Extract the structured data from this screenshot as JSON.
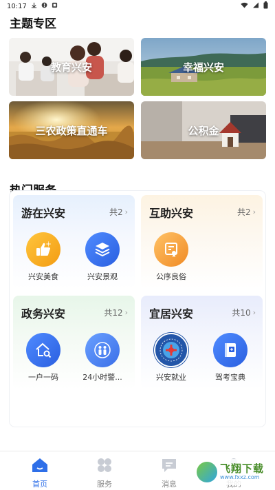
{
  "status_bar": {
    "time": "10:17"
  },
  "theme_section": {
    "title": "主题专区",
    "tiles": [
      {
        "label": "教育兴安"
      },
      {
        "label": "幸福兴安"
      },
      {
        "label": "三农政策直通车"
      },
      {
        "label": "公积金"
      }
    ]
  },
  "hot_section": {
    "title": "热门服务",
    "cards": [
      {
        "title": "游在兴安",
        "count": "共2",
        "items": [
          {
            "label": "兴安美食",
            "icon": "thumbs-up-icon"
          },
          {
            "label": "兴安景观",
            "icon": "layers-icon"
          }
        ]
      },
      {
        "title": "互助兴安",
        "count": "共2",
        "items": [
          {
            "label": "公序良俗",
            "icon": "certificate-icon"
          }
        ]
      },
      {
        "title": "政务兴安",
        "count": "共12",
        "items": [
          {
            "label": "一户一码",
            "icon": "house-search-icon"
          },
          {
            "label": "24小时警...",
            "icon": "police-people-icon"
          }
        ]
      },
      {
        "title": "宜居兴安",
        "count": "共10",
        "items": [
          {
            "label": "兴安就业",
            "icon": "employment-emblem-icon"
          },
          {
            "label": "驾考宝典",
            "icon": "driving-book-icon"
          }
        ]
      }
    ]
  },
  "bottom_nav": {
    "items": [
      {
        "label": "首页",
        "icon": "home-icon",
        "active": true
      },
      {
        "label": "服务",
        "icon": "grid-icon",
        "active": false
      },
      {
        "label": "消息",
        "icon": "message-icon",
        "active": false
      },
      {
        "label": "我的",
        "icon": "user-icon",
        "active": false
      }
    ]
  },
  "watermark": {
    "text_cn": "飞翔下载",
    "text_en": "www.fxxz.com"
  },
  "colors": {
    "accent": "#2e6fe8",
    "orange": "#f6a623",
    "blue": "#3b6ff0"
  }
}
